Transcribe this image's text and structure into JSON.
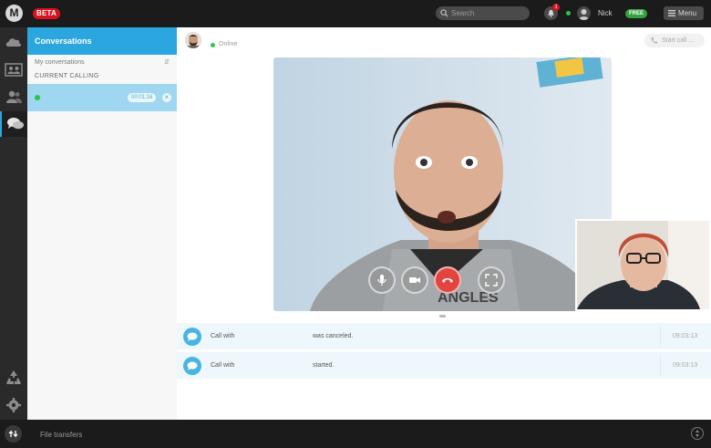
{
  "topbar": {
    "logo": "M",
    "beta_label": "BETA",
    "search_placeholder": "Search",
    "notification_count": "1",
    "username": "Nick",
    "plan_badge": "FREE",
    "menu_label": "Menu"
  },
  "sidebar": {
    "items": [
      {
        "icon": "cloud-icon"
      },
      {
        "icon": "contacts-card-icon"
      },
      {
        "icon": "people-icon"
      },
      {
        "icon": "chat-bubbles-icon"
      },
      {
        "icon": "recycle-bin-icon"
      },
      {
        "icon": "gear-icon"
      }
    ]
  },
  "conversations": {
    "title": "Conversations",
    "sort_label": "My conversations",
    "section_label": "CURRENT CALLING",
    "active_call": {
      "timer": "00:01:16"
    }
  },
  "call": {
    "status_text": "Online",
    "start_call_label": "Start call ...",
    "controls": [
      "microphone-icon",
      "video-camera-icon",
      "hangup-icon",
      "fullscreen-icon"
    ]
  },
  "log": [
    {
      "prefix": "Call with",
      "status": "was canceled.",
      "time": "09:03:13"
    },
    {
      "prefix": "Call with",
      "status": "started.",
      "time": "09:03:13"
    }
  ],
  "bottombar": {
    "transfers_label": "File transfers"
  },
  "colors": {
    "accent": "#2ba6de",
    "beta": "#d8121e",
    "online": "#2fc24e",
    "hangup": "#e2443f"
  }
}
